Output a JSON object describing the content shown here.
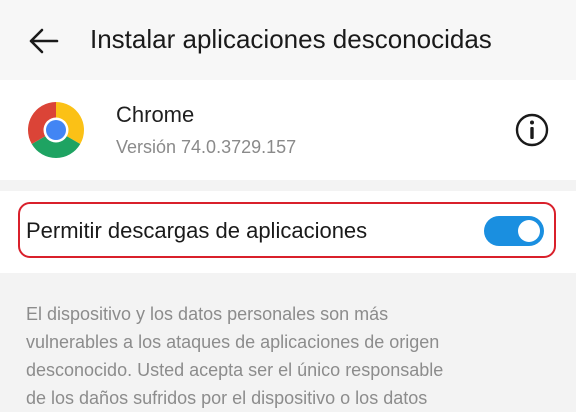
{
  "header": {
    "title": "Instalar aplicaciones desconocidas",
    "back_icon": "arrow-left-icon"
  },
  "app": {
    "name": "Chrome",
    "version": "Versión 74.0.3729.157",
    "icon": "chrome-icon",
    "info_icon": "info-icon"
  },
  "setting": {
    "label": "Permitir descargas de aplicaciones",
    "enabled": true
  },
  "description": {
    "lines": [
      "El dispositivo y los datos personales son más",
      "vulnerables a los ataques de aplicaciones de origen",
      "desconocido. Usted acepta ser el único responsable",
      "de los daños sufridos por el dispositivo o los datos"
    ]
  },
  "colors": {
    "accent": "#1a8fe0",
    "highlight": "#d9202b",
    "background": "#f3f3f3"
  }
}
